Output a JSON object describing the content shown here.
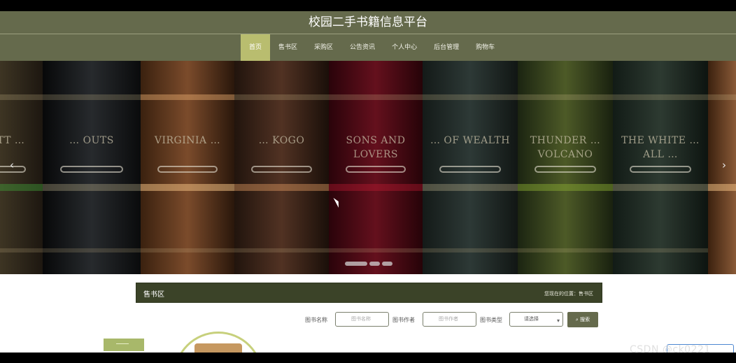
{
  "header": {
    "title": "校园二手书籍信息平台"
  },
  "nav": {
    "items": [
      "首页",
      "售书区",
      "采购区",
      "公告资讯",
      "个人中心",
      "后台管理",
      "购物车"
    ],
    "active_index": 0
  },
  "banner": {
    "books": [
      {
        "title": "… WITT …"
      },
      {
        "title": "… OUTS"
      },
      {
        "title": "VIRGINIA …"
      },
      {
        "title": "… KOGO"
      },
      {
        "title": "SONS AND LOVERS"
      },
      {
        "title": "… OF WEALTH"
      },
      {
        "title": "THUNDER … VOLCANO"
      },
      {
        "title": "THE WHITE … ALL …"
      },
      {
        "title": ""
      }
    ],
    "prev_icon": "‹",
    "next_icon": "›"
  },
  "section": {
    "title": "售书区",
    "breadcrumb": "您现在的位置：售书区"
  },
  "search": {
    "name_label": "图书名称",
    "name_placeholder": "图书名称",
    "author_label": "图书作者",
    "author_placeholder": "图书作者",
    "category_label": "图书类型",
    "category_selected": "请选择",
    "button_label": "搜索"
  },
  "watermark": "CSDN @ck0221",
  "colors": {
    "header": "#656a4c",
    "active_nav": "#b9bd6f",
    "section": "#3b4328"
  }
}
